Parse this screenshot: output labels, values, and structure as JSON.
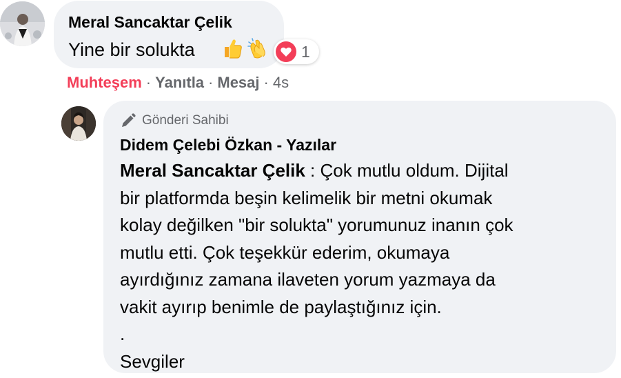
{
  "comment": {
    "author": "Meral Sancaktar Çelik",
    "text": "Yine bir solukta",
    "emojis": [
      "thumbs-up-icon",
      "clapping-hands-icon"
    ],
    "reaction": {
      "type": "love",
      "count": "1",
      "color": "#f33e58"
    },
    "actions": {
      "reaction_label": "Muhteşem",
      "reply_label": "Yanıtla",
      "message_label": "Mesaj",
      "time": "4s",
      "separator": "·"
    }
  },
  "reply": {
    "badge_label": "Gönderi Sahibi",
    "author": "Didem Çelebi Özkan - Yazılar",
    "mention": "Meral Sancaktar Çelik",
    "lines": [
      " : Çok mutlu oldum. Dijital",
      "bir platformda beşin kelimelik bir metni okumak",
      "kolay değilken \"bir solukta\" yorumunuz inanın çok",
      "mutlu etti. Çok teşekkür ederim, okumaya",
      "ayırdığınız zamana ilaveten yorum yazmaya da",
      "vakit ayırıp benimle de paylaştığınız için.",
      ".",
      "Sevgiler"
    ]
  },
  "colors": {
    "bubble": "#f0f2f5",
    "secondary_text": "#65676b",
    "primary_text": "#050505",
    "love_red": "#f33e58"
  }
}
